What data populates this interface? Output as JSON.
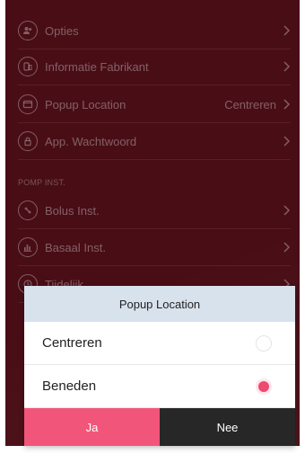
{
  "settings": {
    "items": [
      {
        "label": "Opties",
        "value": "",
        "icon": "users-icon"
      },
      {
        "label": "Informatie Fabrikant",
        "value": "",
        "icon": "device-info-icon"
      },
      {
        "label": "Popup Location",
        "value": "Centreren",
        "icon": "popup-icon"
      },
      {
        "label": "App. Wachtwoord",
        "value": "",
        "icon": "lock-icon"
      }
    ],
    "section_label": "POMP INST.",
    "pump_items": [
      {
        "label": "Bolus Inst.",
        "icon": "bolus-icon"
      },
      {
        "label": "Basaal Inst.",
        "icon": "bar-chart-icon"
      },
      {
        "label": "Tijdelijk...",
        "icon": "clock-icon"
      }
    ]
  },
  "dialog": {
    "title": "Popup Location",
    "options": [
      {
        "label": "Centreren",
        "selected": false
      },
      {
        "label": "Beneden",
        "selected": true
      }
    ],
    "yes_label": "Ja",
    "no_label": "Nee"
  },
  "colors": {
    "background": "#5a111b",
    "accent": "#f2557a",
    "dark_button": "#272727",
    "dialog_header": "#d8e2ed"
  }
}
